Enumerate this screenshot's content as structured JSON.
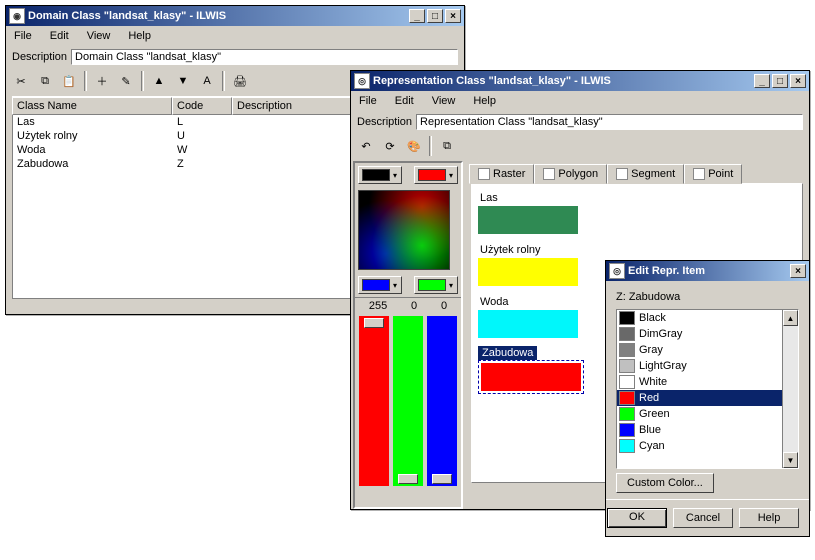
{
  "domain_window": {
    "title": "Domain Class \"landsat_klasy\" - ILWIS",
    "menus": [
      "File",
      "Edit",
      "View",
      "Help"
    ],
    "desc_label": "Description",
    "desc_value": "Domain Class \"landsat_klasy\"",
    "columns": [
      "Class Name",
      "Code",
      "Description"
    ],
    "rows": [
      {
        "name": "Las",
        "code": "L",
        "desc": ""
      },
      {
        "name": "Użytek rolny",
        "code": "U",
        "desc": ""
      },
      {
        "name": "Woda",
        "code": "W",
        "desc": ""
      },
      {
        "name": "Zabudowa",
        "code": "Z",
        "desc": ""
      }
    ]
  },
  "rep_window": {
    "title": "Representation Class \"landsat_klasy\" - ILWIS",
    "menus": [
      "File",
      "Edit",
      "View",
      "Help"
    ],
    "desc_label": "Description",
    "desc_value": "Representation Class \"landsat_klasy\"",
    "slider_values": [
      "255",
      "0",
      "0"
    ],
    "tabs": [
      "Raster",
      "Polygon",
      "Segment",
      "Point"
    ],
    "classes": [
      {
        "name": "Las",
        "color": "#2f8a53"
      },
      {
        "name": "Użytek rolny",
        "color": "#ffff00"
      },
      {
        "name": "Woda",
        "color": "#00f7fb"
      },
      {
        "name": "Zabudowa",
        "color": "#ff0000",
        "selected": true
      }
    ]
  },
  "dialog": {
    "title": "Edit Repr. Item",
    "item_label": "Z: Zabudowa",
    "colors": [
      {
        "name": "Black",
        "hex": "#000000"
      },
      {
        "name": "DimGray",
        "hex": "#696969"
      },
      {
        "name": "Gray",
        "hex": "#808080"
      },
      {
        "name": "LightGray",
        "hex": "#c0c0c0"
      },
      {
        "name": "White",
        "hex": "#ffffff"
      },
      {
        "name": "Red",
        "hex": "#ff0000",
        "selected": true
      },
      {
        "name": "Green",
        "hex": "#00ff00"
      },
      {
        "name": "Blue",
        "hex": "#0000ff"
      },
      {
        "name": "Cyan",
        "hex": "#00ffff"
      }
    ],
    "custom_btn": "Custom Color...",
    "buttons": {
      "ok": "OK",
      "cancel": "Cancel",
      "help": "Help"
    }
  }
}
